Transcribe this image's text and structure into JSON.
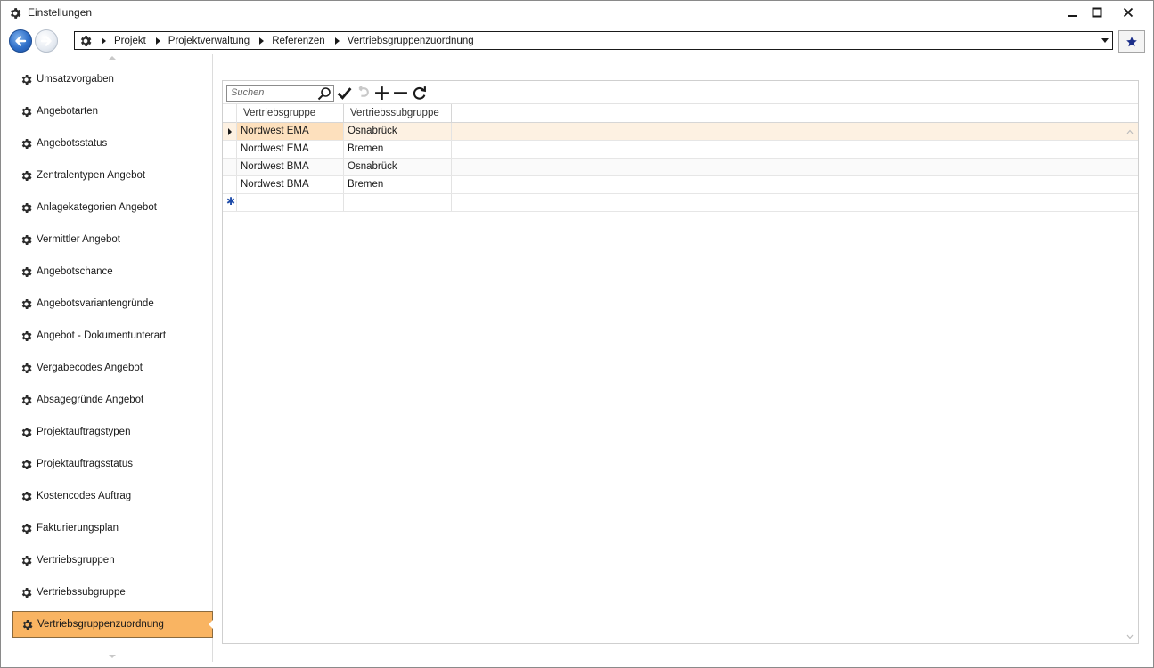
{
  "window": {
    "title": "Einstellungen"
  },
  "breadcrumb": [
    "Projekt",
    "Projektverwaltung",
    "Referenzen",
    "Vertriebsgruppenzuordnung"
  ],
  "sidebar": {
    "items": [
      {
        "label": "Umsatzvorgaben"
      },
      {
        "label": "Angebotarten"
      },
      {
        "label": "Angebotsstatus"
      },
      {
        "label": "Zentralentypen Angebot"
      },
      {
        "label": "Anlagekategorien Angebot"
      },
      {
        "label": "Vermittler Angebot"
      },
      {
        "label": "Angebotschance"
      },
      {
        "label": "Angebotsvariantengründe"
      },
      {
        "label": "Angebot - Dokumentunterart"
      },
      {
        "label": "Vergabecodes Angebot"
      },
      {
        "label": "Absagegründe Angebot"
      },
      {
        "label": "Projektauftragstypen"
      },
      {
        "label": "Projektauftragsstatus"
      },
      {
        "label": "Kostencodes Auftrag"
      },
      {
        "label": "Fakturierungsplan"
      },
      {
        "label": "Vertriebsgruppen"
      },
      {
        "label": "Vertriebssubgruppe"
      },
      {
        "label": "Vertriebsgruppenzuordnung"
      }
    ],
    "active_index": 17
  },
  "toolbar": {
    "search_placeholder": "Suchen"
  },
  "grid": {
    "columns": [
      "Vertriebsgruppe",
      "Vertriebssubgruppe"
    ],
    "rows": [
      [
        "Nordwest EMA",
        "Osnabrück"
      ],
      [
        "Nordwest EMA",
        "Bremen"
      ],
      [
        "Nordwest BMA",
        "Osnabrück"
      ],
      [
        "Nordwest BMA",
        "Bremen"
      ]
    ],
    "selected_row": 0
  },
  "colors": {
    "active_item": "#f9b462",
    "selected_row": "#fdf1e2",
    "focused_cell": "#fde0bd",
    "nav_back": "#2f6fc9",
    "favorite_star": "#1c2f8a"
  }
}
